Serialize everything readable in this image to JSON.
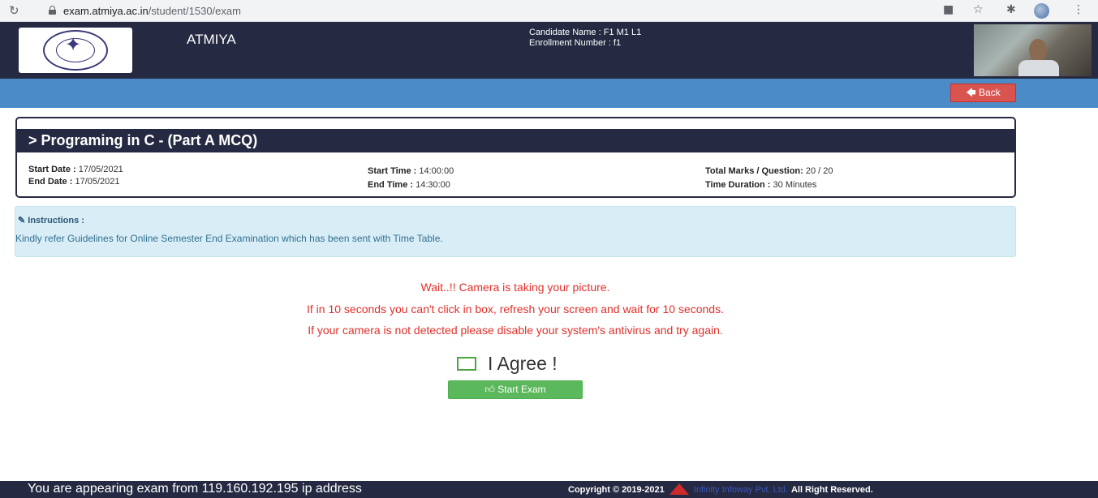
{
  "browser": {
    "url_host": "exam.atmiya.ac.in",
    "url_path": "/student/1530/exam",
    "icons": [
      "reload-icon",
      "lock-icon",
      "camera-ext-icon",
      "star-icon",
      "extensions-icon",
      "profile-icon",
      "menu-icon"
    ]
  },
  "header": {
    "brand": "ATMIYA",
    "candidate_name": "Candidate Name : F1 M1 L1",
    "enrollment_number": "Enrollment Number : f1"
  },
  "toolbar": {
    "back_label": "Back"
  },
  "exam": {
    "title": "> Programing in C - (Part A MCQ)",
    "start_date_label": "Start Date :",
    "start_date": "17/05/2021",
    "end_date_label": "End Date :",
    "end_date": "17/05/2021",
    "start_time_label": "Start Time :",
    "start_time": "14:00:00",
    "end_time_label": "End Time :",
    "end_time": "14:30:00",
    "total_marks_label": "Total Marks / Question:",
    "total_marks": "20 / 20",
    "duration_label": "Time Duration :",
    "duration": "30 Minutes"
  },
  "instructions": {
    "title": "Instructions :",
    "text": "Kindly refer Guidelines for Online Semester End Examination which has been sent with Time Table."
  },
  "messages": [
    "Wait..!! Camera is taking your picture.",
    "If in 10 seconds you can't click in box, refresh your screen and wait for 10 seconds.",
    "If your camera is not detected please disable your system's antivirus and try again."
  ],
  "agree": {
    "label": "I Agree !",
    "checked": false
  },
  "start_button": {
    "label": "Start Exam"
  },
  "footer": {
    "ip_text": "You are appearing exam from 119.160.192.195 ip address",
    "copyright": "Copyright © 2019-2021",
    "company": "Infinity Infoway Pvt. Ltd.",
    "rights": "All Right Reserved."
  },
  "colors": {
    "navy": "#252a42",
    "blue_bar": "#4b8cc8",
    "danger": "#d9534f",
    "success": "#5cb85c",
    "info_bg": "#d9edf7",
    "message_red": "#e0302a"
  }
}
